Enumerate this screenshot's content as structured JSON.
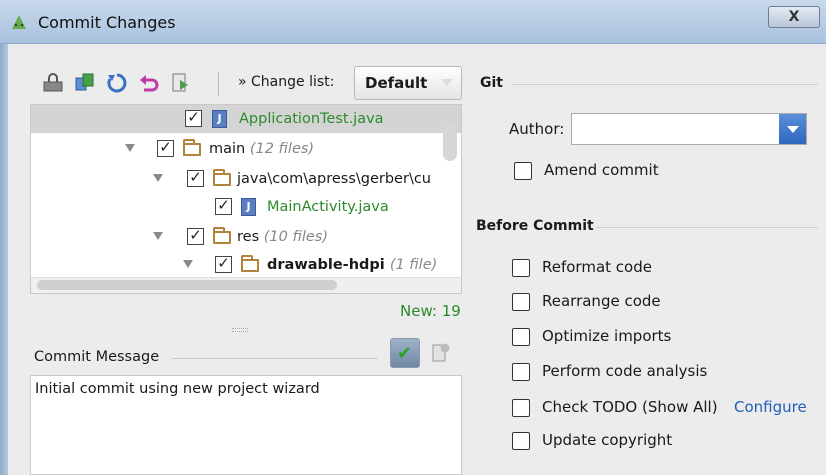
{
  "window": {
    "title": "Commit Changes",
    "close_glyph": "X",
    "app_icon": "android-icon"
  },
  "toolbar": {
    "icons": [
      "show-diff-icon",
      "move-to-changelist-icon",
      "refresh-icon",
      "rollback-icon",
      "jump-to-source-icon"
    ],
    "changelist_prefix": "» ",
    "changelist_label": "Change list:",
    "changelist_value": "Default"
  },
  "tree": {
    "rows": [
      {
        "label": "ApplicationTest.java",
        "extra": "",
        "type": "java",
        "checked": true,
        "color": "#2b8a2b"
      },
      {
        "label": "main",
        "extra": "(12 files)",
        "type": "folder",
        "checked": true
      },
      {
        "label": "java\\com\\apress\\gerber\\cu",
        "extra": "",
        "type": "folder",
        "checked": true
      },
      {
        "label": "MainActivity.java",
        "extra": "",
        "type": "java",
        "checked": true,
        "color": "#2b8a2b"
      },
      {
        "label": "res",
        "extra": "(10 files)",
        "type": "folder",
        "checked": true
      },
      {
        "label": "drawable-hdpi",
        "extra": "(1 file)",
        "type": "folder",
        "checked": true
      }
    ],
    "new_count": "New: 19"
  },
  "commit_message": {
    "label": "Commit Message",
    "text": "Initial commit using new project wizard"
  },
  "git": {
    "section_title": "Git",
    "author_label": "Author:",
    "author_value": "",
    "amend_label": "Amend commit"
  },
  "before_commit": {
    "section_title": "Before Commit",
    "options": [
      {
        "label": "Reformat code",
        "checked": false
      },
      {
        "label": "Rearrange code",
        "checked": false
      },
      {
        "label": "Optimize imports",
        "checked": false
      },
      {
        "label": "Perform code analysis",
        "checked": false
      },
      {
        "label": "Check TODO (Show All)",
        "checked": false
      },
      {
        "label": "Update copyright",
        "checked": false
      }
    ],
    "configure_link": "Configure"
  }
}
